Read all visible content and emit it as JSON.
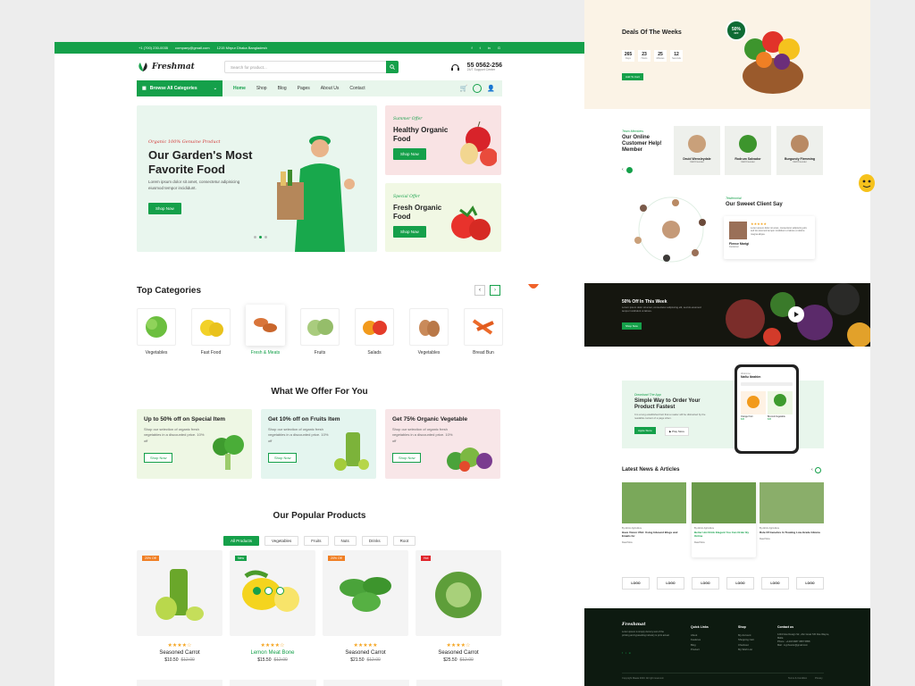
{
  "topbar": {
    "phone": "+1 (700) 230-0035",
    "email": "company@gmail.com",
    "address": "1215 Mirpur Dhaka Bangladesh"
  },
  "header": {
    "logo": "Freshmat",
    "search_placeholder": "Search for product...",
    "phone": "55 0562-256",
    "support": "24/7 Support Center"
  },
  "nav": {
    "browse": "Browse All Categories",
    "items": [
      "Home",
      "Shop",
      "Blog",
      "Pages",
      "About Us",
      "Contact"
    ]
  },
  "hero": {
    "tag": "Organic 100% Genuine Product",
    "title1": "Our Garden's Most",
    "title2": "Favorite Food",
    "desc1": "Lorem ipsum dolor sit amet, consectetur adipisicing",
    "desc2": "eiusmod tempor incididunt.",
    "button": "Shop Now"
  },
  "banners": [
    {
      "tag": "Summer Offer",
      "title1": "Healthy Organic",
      "title2": "Food",
      "button": "Shop Now"
    },
    {
      "tag": "Special Offer",
      "title1": "Fresh Organic",
      "title2": "Food",
      "button": "Shop Now"
    }
  ],
  "categories": {
    "title": "Top Categories",
    "items": [
      "Vegetables",
      "Fast Food",
      "Fresh & Meats",
      "Fruits",
      "Salads",
      "Vegetables",
      "Bread Bun"
    ]
  },
  "offers": {
    "title": "What We Offer For You",
    "items": [
      {
        "title": "Up to 50% off on Special Item",
        "desc": "Shop our selection of organic fresh vegetables in a discounted price. 10% off",
        "button": "Shop Now"
      },
      {
        "title": "Get 10% off on Fruits Item",
        "desc": "Shop our selection of organic fresh vegetables in a discounted price. 10% off",
        "button": "Shop Now"
      },
      {
        "title": "Get 75% Organic Vegetable",
        "desc": "Shop our selection of organic fresh vegetables in a discounted price. 10% off",
        "button": "Shop Now"
      }
    ]
  },
  "products": {
    "title": "Our Popular Products",
    "tabs": [
      "All Products",
      "Vegetables",
      "Fruits",
      "Nuts",
      "Drinks",
      "Root"
    ],
    "items": [
      {
        "badge": "20% Off",
        "name": "Seasoned Carrot",
        "price": "$10.50",
        "old": "$12.00",
        "stars": "★★★★☆"
      },
      {
        "badge": "New",
        "name": "Lemon Meat Bone",
        "price": "$15.50",
        "old": "$12.00",
        "stars": "★★★★☆"
      },
      {
        "badge": "20% Off",
        "name": "Seasoned Carrot",
        "price": "$21.50",
        "old": "$12.00",
        "stars": "★★★★★"
      },
      {
        "badge": "Hot",
        "name": "Seasoned Carrot",
        "price": "$25.50",
        "old": "$12.00",
        "stars": "★★★★☆"
      }
    ]
  },
  "deals": {
    "title": "Deals Of The Weeks",
    "countdown": [
      "265",
      "23",
      "25",
      "12"
    ],
    "units": [
      "Days",
      "Hours",
      "Minutes",
      "Seconds"
    ],
    "badge": "50%",
    "badge_sub": "OFF",
    "button": "Add To Cart"
  },
  "team": {
    "tag": "Team Members",
    "title1": "Our Online",
    "title2": "Customer Help!",
    "title3": "Member",
    "members": [
      {
        "name": "Druid Wensleydale",
        "role": "CEO Founder"
      },
      {
        "name": "Rodrum Salvador",
        "role": "CEO Founder"
      },
      {
        "name": "Burgundy Flemming",
        "role": "CEO Founder"
      }
    ]
  },
  "testimonial": {
    "tag": "Testimonial",
    "title": "Our Sweeet Client Say",
    "text": "Lorem ipsum dolor sit amet, consectetur adipiscing elit, sed do eiusmod tempor incididunt ut labore et dolore magna aliqua.",
    "name": "Fleece Marigi",
    "role": "Customer"
  },
  "promo": {
    "title": "50% Off In This Week",
    "desc": "Lorem ipsum dolor sit amet, consectetur adipiscing elit, sed do eiusmod tempor incididunt ut labore.",
    "button": "Shop Now"
  },
  "app": {
    "tag": "Download The App",
    "title1": "Simple Way to Order Your",
    "title2": "Product Fastest",
    "desc": "It is a long established fact that a reader will be distracted by the readable content of a page when.",
    "apple": "Apple Store",
    "google": "Play Store",
    "welcome": "Welcome",
    "user": "Nafiu Ibrahim",
    "items": [
      "Orange Fruit",
      "Broccoli Vegetable"
    ],
    "prices": [
      "$45",
      "$45"
    ]
  },
  "news": {
    "title": "Latest News & Articles",
    "items": [
      {
        "meta": "By Admin  Agriculture",
        "title": "Have Vision USA: Using Inbound Blogs and Emails for",
        "link": "Read More"
      },
      {
        "meta": "By Admin  Agriculture",
        "title": "Better Hot Drink Elegant You Can Order By Online",
        "link": "Read More"
      },
      {
        "meta": "By Admin  Agriculture",
        "title": "Role Of Genetics In Treating Low-Grade Glioma",
        "link": "Read More"
      }
    ]
  },
  "logos": [
    "LOGO",
    "LOGO",
    "LOGO",
    "LOGO",
    "LOGO",
    "LOGO"
  ],
  "footer": {
    "logo": "Freshmat",
    "about": "Lorem ipsum is simply dummy text of the printing and typesetting industry is print actual.",
    "quick_title": "Quick Links",
    "quick": [
      "About",
      "Features",
      "Blog",
      "Product"
    ],
    "shop_title": "Shop",
    "shop": [
      "My Account",
      "Shopping Cart",
      "Checkout",
      "My Wish List"
    ],
    "contact_title": "Contact us",
    "contact": [
      "1234 New Design Str., Abc Great 720 Doe Wayne, Malta",
      "Phone : +1234 9687 4587 5858",
      "Mail : myphoenix@gmail.com"
    ],
    "copyright": "Copyright Maata 2023. All right reserved.",
    "terms": "Terms & Condition",
    "privacy": "Privacy"
  },
  "colors": {
    "brand": "#15a04a",
    "dark_footer": "#0d1a10",
    "star": "#f5a623"
  }
}
